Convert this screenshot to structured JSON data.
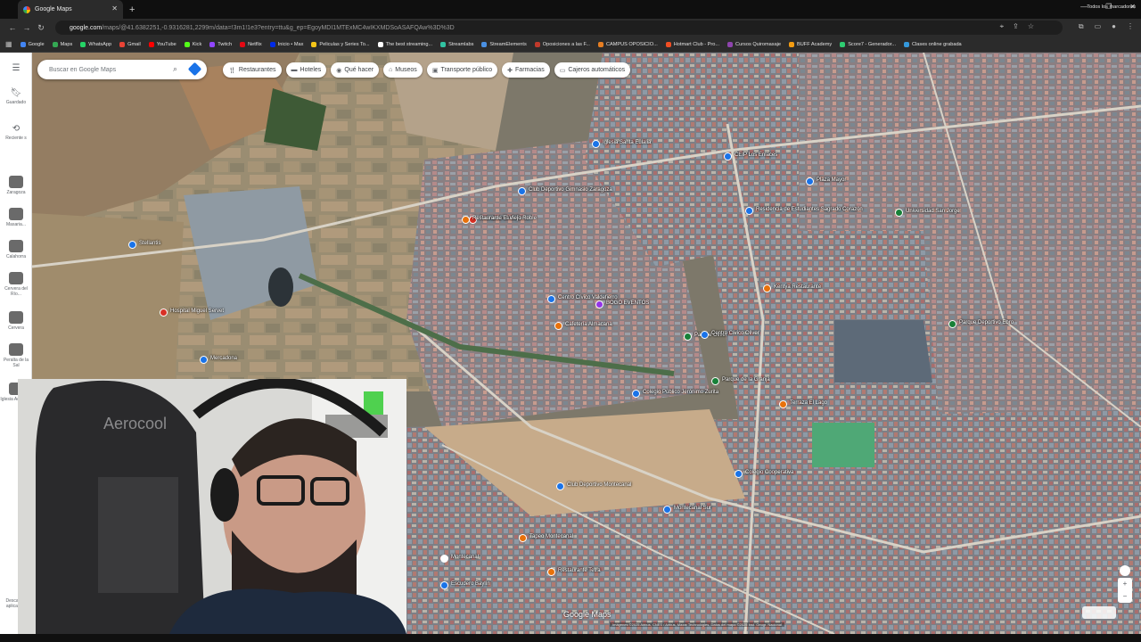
{
  "browser": {
    "tab_title": "Google Maps",
    "url_host": "google.com",
    "url_path": "/maps/@41.6382251,-0.9316281,2299m/data=!3m1!1e3?entry=ttu&g_ep=EgoyMDI1MTExMC4wIKXMDSoASAFQAw%3D%3D",
    "bookmarks": [
      {
        "label": "Google",
        "color": "#4285f4"
      },
      {
        "label": "Maps",
        "color": "#34a853"
      },
      {
        "label": "WhatsApp",
        "color": "#25d366"
      },
      {
        "label": "Gmail",
        "color": "#ea4335"
      },
      {
        "label": "YouTube",
        "color": "#ff0000"
      },
      {
        "label": "Kick",
        "color": "#53fc18"
      },
      {
        "label": "Twitch",
        "color": "#9146ff"
      },
      {
        "label": "Netflix",
        "color": "#e50914"
      },
      {
        "label": "Inicio • Max",
        "color": "#002be7"
      },
      {
        "label": "Peliculas y Series To...",
        "color": "#f5c518"
      },
      {
        "label": "The best streaming...",
        "color": "#ffffff"
      },
      {
        "label": "Streamlabs",
        "color": "#31c3a2"
      },
      {
        "label": "StreamElements",
        "color": "#4a90e2"
      },
      {
        "label": "Oposiciones a las F...",
        "color": "#c0392b"
      },
      {
        "label": "CAMPUS OPOSICIO...",
        "color": "#e67e22"
      },
      {
        "label": "Hotmart Club - Pro...",
        "color": "#f04e23"
      },
      {
        "label": "Cursos Quiromasaje",
        "color": "#8e44ad"
      },
      {
        "label": "BUFF Academy",
        "color": "#f39c12"
      },
      {
        "label": "Score7 - Generador...",
        "color": "#2ecc71"
      },
      {
        "label": "Clases online grabada",
        "color": "#3498db"
      }
    ],
    "all_bookmarks_label": "Todos los marcadores"
  },
  "sidebar": {
    "saved_label": "Guardado",
    "recents_label": "Reciente s",
    "recent_places": [
      "Zaragoza",
      "Masaria...",
      "Calahorra",
      "Cervera del Río...",
      "Cervera",
      "Peralta de la Sal",
      "Iglesia Advent..."
    ],
    "bottom_label": "Descargar aplicación"
  },
  "map": {
    "search_placeholder": "Buscar en Google Maps",
    "chips": [
      {
        "label": "Restaurantes",
        "icon": "restaurant-icon"
      },
      {
        "label": "Hoteles",
        "icon": "hotel-icon"
      },
      {
        "label": "Qué hacer",
        "icon": "camera-icon"
      },
      {
        "label": "Museos",
        "icon": "museum-icon"
      },
      {
        "label": "Transporte público",
        "icon": "transit-icon"
      },
      {
        "label": "Farmacias",
        "icon": "pharmacy-icon"
      },
      {
        "label": "Cajeros automáticos",
        "icon": "atm-icon"
      }
    ],
    "places": [
      "Centro Cívico Valdefierro",
      "Cafetería Almacana",
      "BOGO EVENTOS",
      "Farmacia Valdefierro",
      "Restaurante El Viejo Roble",
      "Hospital Miguel Servet",
      "Club Deportivo Gimnasio Zaragoza",
      "Parque de la Granja",
      "Colegio Público Jerónimo Zurita",
      "Kentya Restaurante",
      "CEIP Los Enlaces",
      "Residencia de Estudiantes Sagrado Corazón",
      "Parque Oliver",
      "Centro Cívico Oliver",
      "Terraza El Lago",
      "Tapeo Montecanal",
      "Restaurante Tetra",
      "Colegio Cooperativa",
      "Montecanal",
      "Escudero Baylín",
      "Club Deportivo Montecanal",
      "Iglesia Santa Eulalia",
      "Stellantis",
      "Mercadona",
      "Plaza Mayor",
      "Montecanal Sur",
      "Universidad San Jorge",
      "Parque Deportivo Ebro"
    ],
    "attribution": "Imágenes ©2025 Airbus, CNES / Airbus, Maxar Technologies, Datos del mapa ©2025 Inst. Geogr. Nacional",
    "logo": "Google Maps"
  },
  "webcam": {
    "chair_brand": "Aerocool"
  }
}
